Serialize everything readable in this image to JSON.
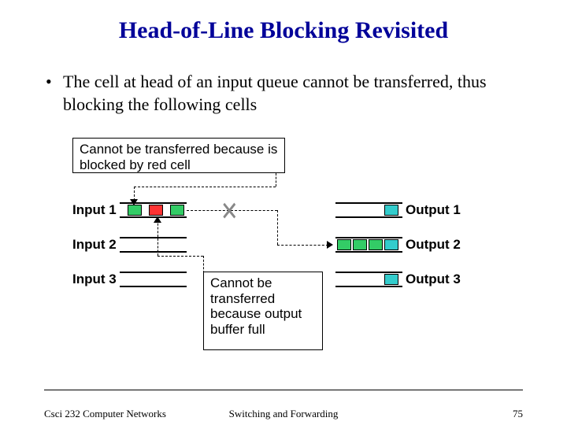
{
  "title": "Head-of-Line Blocking Revisited",
  "bullet": "The cell at head of an input queue cannot be transferred, thus blocking the following cells",
  "notes": {
    "top": "Cannot be transferred because is blocked by red cell",
    "mid": "Cannot be transferred because output buffer full"
  },
  "ports": {
    "in1": "Input 1",
    "in2": "Input 2",
    "in3": "Input 3",
    "out1": "Output 1",
    "out2": "Output 2",
    "out3": "Output 3"
  },
  "footer": {
    "left": "Csci 232 Computer Networks",
    "center": "Switching and Forwarding",
    "right": "75"
  }
}
